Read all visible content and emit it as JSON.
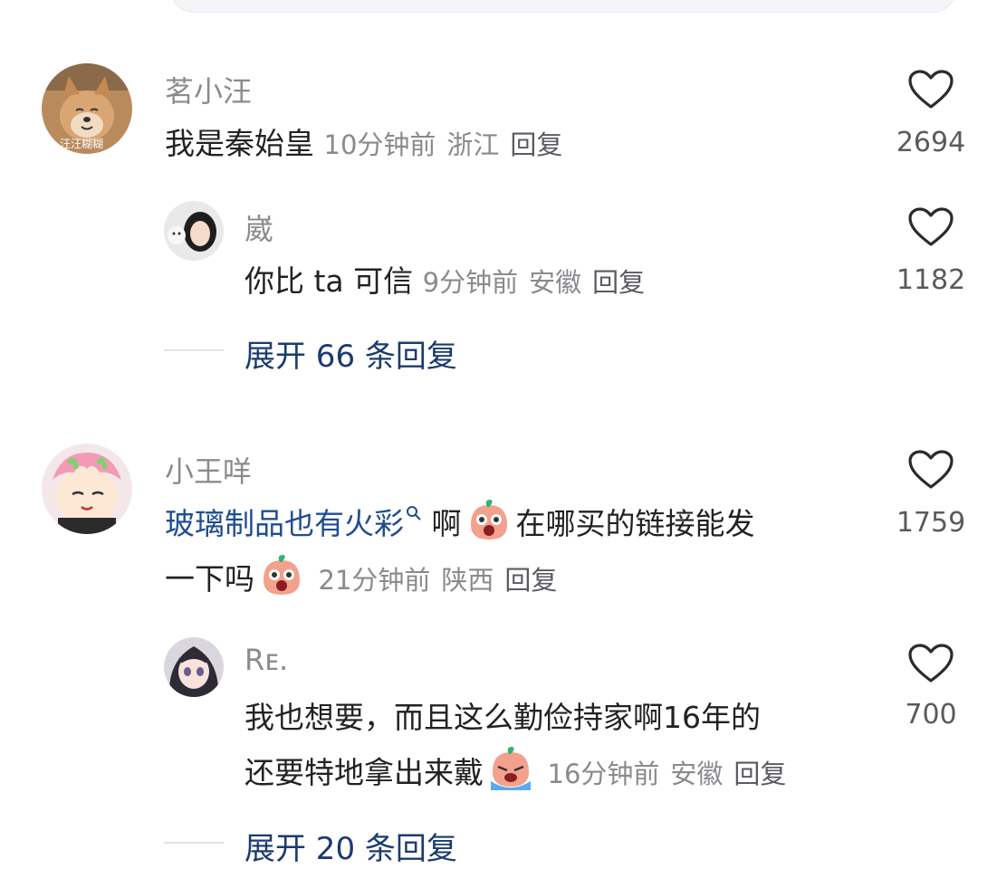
{
  "comments": [
    {
      "user": "茗小汪",
      "avatar_label": "汪汪糊糊",
      "text": "我是秦始皇",
      "time": "10分钟前",
      "location": "浙江",
      "reply_label": "回复",
      "likes": "2694",
      "replies": [
        {
          "user": "崴",
          "text": "你比 ta 可信",
          "time": "9分钟前",
          "location": "安徽",
          "reply_label": "回复",
          "likes": "1182"
        }
      ],
      "expand_label": "展开 66 条回复"
    },
    {
      "user": "小王咩",
      "text_link": "玻璃制品也有火彩",
      "text_after_link": "啊",
      "text_line1_rest": "在哪买的链接能发",
      "text_line2": "一下吗",
      "time": "21分钟前",
      "location": "陕西",
      "reply_label": "回复",
      "likes": "1759",
      "replies": [
        {
          "user": "Rᴇ.",
          "text_line1": "我也想要，而且这么勤俭持家啊16年的",
          "text_line2": "还要特地拿出来戴",
          "time": "16分钟前",
          "location": "安徽",
          "reply_label": "回复",
          "likes": "700"
        }
      ],
      "expand_label": "展开 20 条回复"
    }
  ],
  "icons": {
    "like": "heart-outline-icon",
    "emoji_surprised": "surprised-emoji-icon",
    "emoji_crying": "crying-emoji-icon",
    "search_hint": "search-icon"
  },
  "colors": {
    "link": "#1f4d8f",
    "username": "#8b8b8f",
    "meta": "#8a8a8e"
  }
}
